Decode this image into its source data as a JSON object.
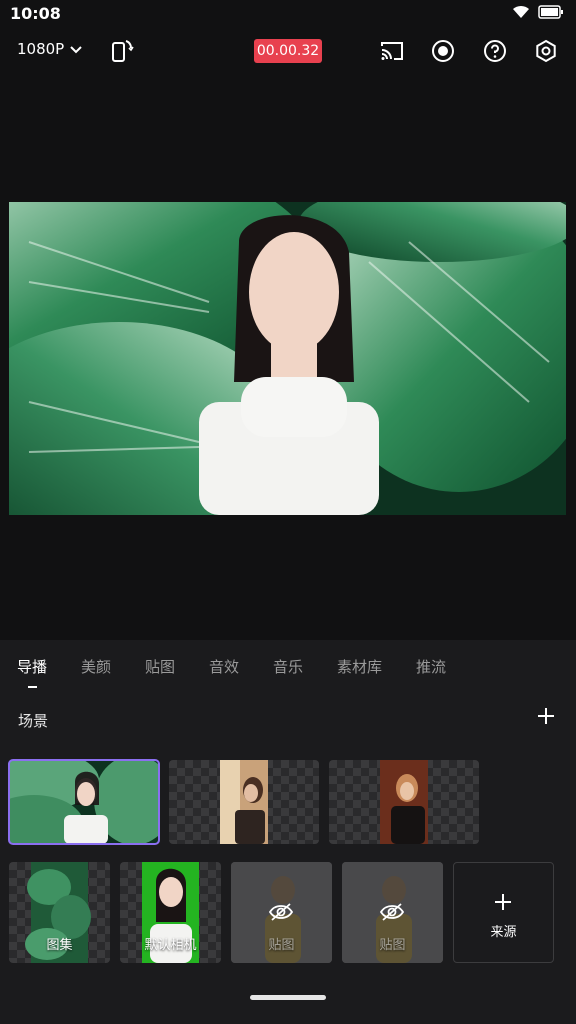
{
  "status": {
    "time": "10:08"
  },
  "toolbar": {
    "resolution": "1080P",
    "timer": "00.00.32",
    "timer_color": "#e8414f"
  },
  "tabs": [
    {
      "label": "导播",
      "active": true
    },
    {
      "label": "美颜"
    },
    {
      "label": "贴图"
    },
    {
      "label": "音效"
    },
    {
      "label": "音乐"
    },
    {
      "label": "素材库"
    },
    {
      "label": "推流"
    }
  ],
  "scene": {
    "title": "场景"
  },
  "sources": {
    "items": [
      {
        "label": "图集"
      },
      {
        "label": "默认相机"
      },
      {
        "label": "贴图"
      },
      {
        "label": "贴图"
      }
    ],
    "add_label": "来源"
  },
  "colors": {
    "accent": "#8b6ff0",
    "panel": "#1b1b1d",
    "background": "#111112"
  }
}
